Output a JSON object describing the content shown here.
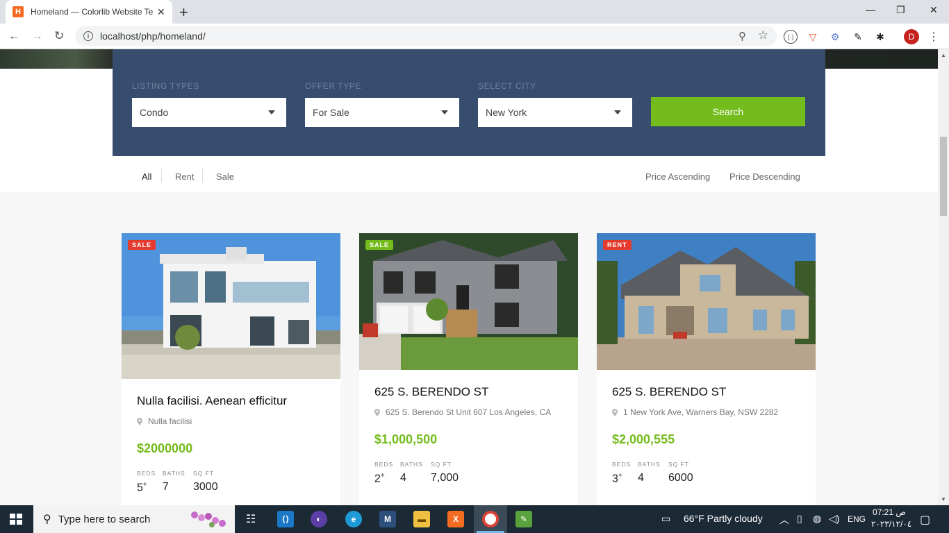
{
  "browser": {
    "tab_title": "Homeland — Colorlib Website Te",
    "url": "localhost/php/homeland/",
    "profile_initial": "D"
  },
  "search": {
    "listing_types_label": "LISTING TYPES",
    "listing_types_value": "Condo",
    "offer_type_label": "OFFER TYPE",
    "offer_type_value": "For Sale",
    "select_city_label": "SELECT CITY",
    "select_city_value": "New York",
    "search_button": "Search"
  },
  "filters": {
    "all": "All",
    "rent": "Rent",
    "sale": "Sale",
    "price_asc": "Price Ascending",
    "price_desc": "Price Descending"
  },
  "listings": [
    {
      "badge": "SALE",
      "title": "Nulla facilisi. Aenean efficitur",
      "address": "Nulla facilisi",
      "price": "$2000000",
      "beds_label": "BEDS",
      "beds": "5",
      "baths_label": "BATHS",
      "baths": "7",
      "sqft_label": "SQ FT",
      "sqft": "3000"
    },
    {
      "badge": "SALE",
      "title": "625 S. BERENDO ST",
      "address": "625 S. Berendo St Unit 607 Los Angeles, CA",
      "price": "$1,000,500",
      "beds_label": "BEDS",
      "beds": "2",
      "baths_label": "BATHS",
      "baths": "4",
      "sqft_label": "SQ FT",
      "sqft": "7,000"
    },
    {
      "badge": "RENT",
      "title": "625 S. BERENDO ST",
      "address": "1 New York Ave, Warners Bay, NSW 2282",
      "price": "$2,000,555",
      "beds_label": "BEDS",
      "beds": "3",
      "baths_label": "BATHS",
      "baths": "4",
      "sqft_label": "SQ FT",
      "sqft": "6000"
    }
  ],
  "taskbar": {
    "search_placeholder": "Type here to search",
    "weather": "66°F  Partly cloudy",
    "language": "ENG",
    "time": "07:21 ص",
    "date": "۲۰۲۳/۱۲/۰٤"
  },
  "colors": {
    "panel": "#364d6e",
    "accent_green": "#74bb1c",
    "badge_red": "#e53b2f"
  }
}
